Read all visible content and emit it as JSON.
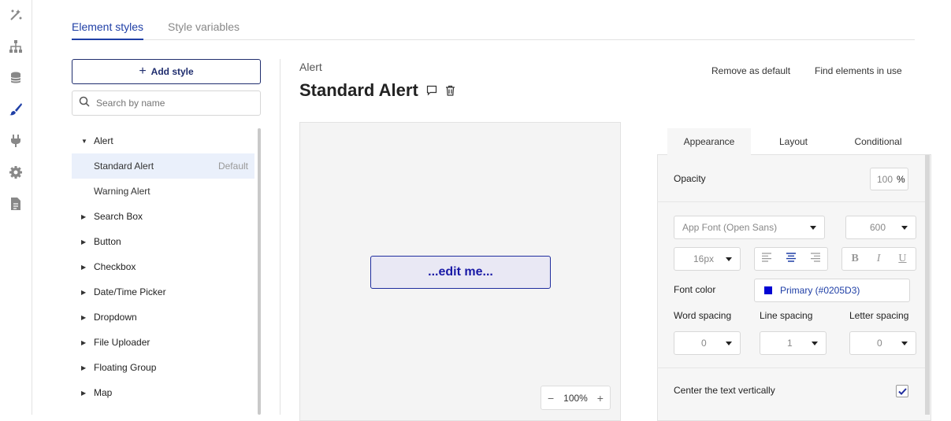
{
  "rail": {
    "icons": [
      "design-icon",
      "hierarchy-icon",
      "database-icon",
      "brush-icon",
      "plugin-icon",
      "settings-icon",
      "document-icon"
    ],
    "active_color": "#1f3fa6"
  },
  "tabs": {
    "element_styles": "Element styles",
    "style_variables": "Style variables"
  },
  "sidebar": {
    "add_style": "Add style",
    "search_placeholder": "Search by name",
    "groups": [
      {
        "label": "Alert",
        "expanded": true,
        "children": [
          {
            "label": "Standard Alert",
            "default": "Default",
            "selected": true
          },
          {
            "label": "Warning Alert"
          }
        ]
      },
      {
        "label": "Search Box"
      },
      {
        "label": "Button"
      },
      {
        "label": "Checkbox"
      },
      {
        "label": "Date/Time Picker"
      },
      {
        "label": "Dropdown"
      },
      {
        "label": "File Uploader"
      },
      {
        "label": "Floating Group"
      },
      {
        "label": "Map"
      }
    ]
  },
  "main": {
    "breadcrumb": "Alert",
    "title": "Standard Alert",
    "remove_default": "Remove as default",
    "find_elements": "Find elements in use",
    "preview_text": "...edit me...",
    "zoom": "100%"
  },
  "panel": {
    "tabs": [
      "Appearance",
      "Layout",
      "Conditional"
    ],
    "opacity_label": "Opacity",
    "opacity_value": "100",
    "opacity_unit": "%",
    "font_family": "App Font (Open Sans)",
    "font_weight": "600",
    "font_size": "16px",
    "font_color_label": "Font color",
    "font_color_value": "Primary (#0205D3)",
    "font_color_hex": "#0205D3",
    "word_spacing_label": "Word spacing",
    "word_spacing": "0",
    "line_spacing_label": "Line spacing",
    "line_spacing": "1",
    "letter_spacing_label": "Letter spacing",
    "letter_spacing": "0",
    "center_text_label": "Center the text vertically",
    "center_text_checked": true
  }
}
